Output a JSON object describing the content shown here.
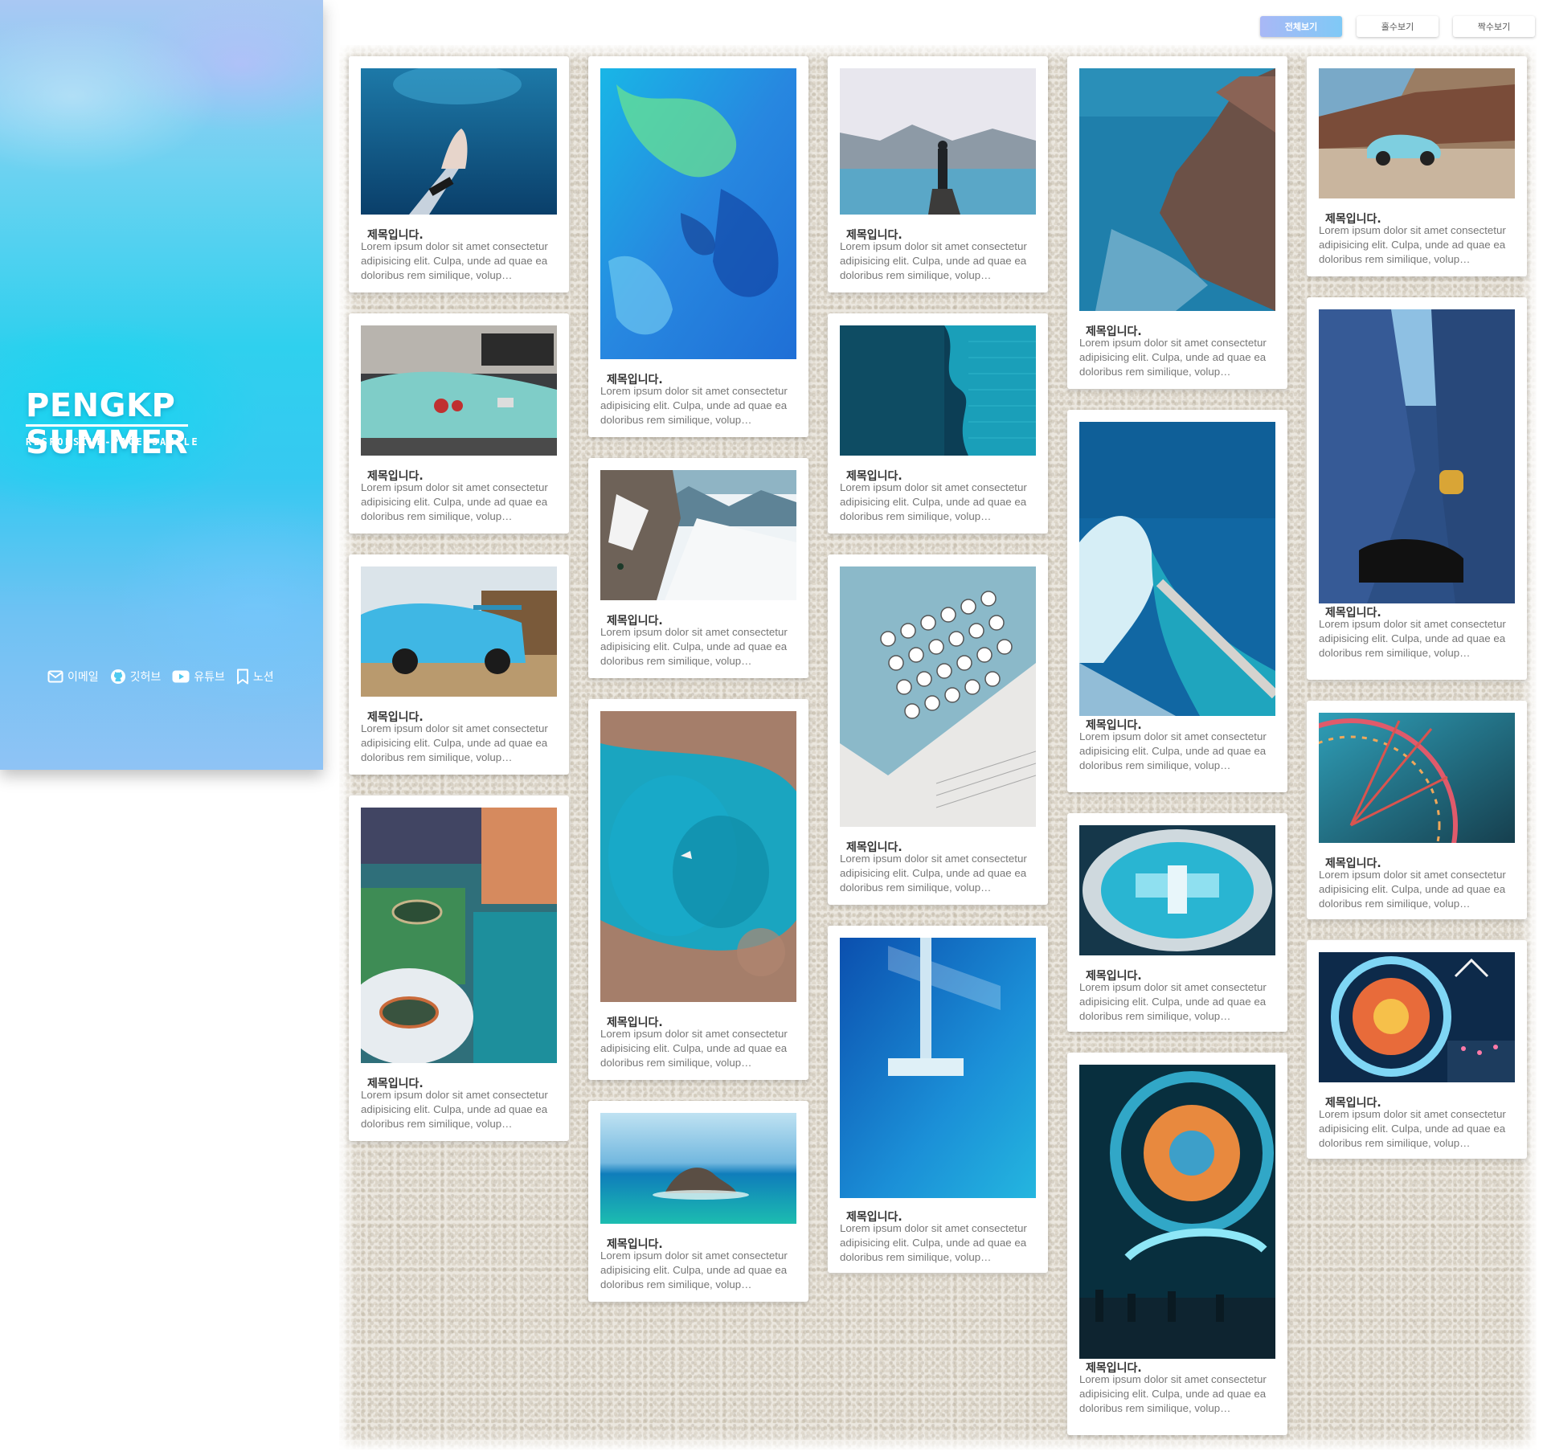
{
  "brand": {
    "title": "PENGKP SUMMER",
    "subtitle": "RESPONSIVE-PAGE-SAMPLE",
    "colors": {
      "accent": "#2fd0ee",
      "accent_secondary": "#a9b8f6"
    }
  },
  "social": [
    {
      "label": "이메일",
      "icon": "mail-icon"
    },
    {
      "label": "깃허브",
      "icon": "github-icon"
    },
    {
      "label": "유튜브",
      "icon": "youtube-icon"
    },
    {
      "label": "노션",
      "icon": "bookmark-icon"
    }
  ],
  "filters": [
    {
      "label": "전체보기",
      "active": true
    },
    {
      "label": "홀수보기",
      "active": false
    },
    {
      "label": "짝수보기",
      "active": false
    }
  ],
  "card_text": {
    "title": "제목입니다.",
    "desc": "Lorem ipsum dolor sit amet consectetur adipisicing elit. Culpa, unde ad quae ea doloribus rem similique, volup…"
  },
  "cards": [
    {
      "image": "underwater-hand",
      "title": "제목입니다.",
      "desc": "Lorem ipsum dolor sit amet consectetur adipisicing elit. Culpa, unde ad quae ea doloribus rem similique, volup…"
    },
    {
      "image": "teal-vintage-car",
      "title": "제목입니다.",
      "desc": "Lorem ipsum dolor sit amet consectetur adipisicing elit. Culpa, unde ad quae ea doloribus rem similique, volup…"
    },
    {
      "image": "blue-sports-car",
      "title": "제목입니다.",
      "desc": "Lorem ipsum dolor sit amet consectetur adipisicing elit. Culpa, unde ad quae ea doloribus rem similique, volup…"
    },
    {
      "image": "table-setting",
      "title": "제목입니다.",
      "desc": "Lorem ipsum dolor sit amet consectetur adipisicing elit. Culpa, unde ad quae ea doloribus rem similique, volup…"
    },
    {
      "image": "blue-abstract",
      "title": "제목입니다.",
      "desc": "Lorem ipsum dolor sit amet consectetur adipisicing elit. Culpa, unde ad quae ea doloribus rem similique, volup…"
    },
    {
      "image": "snow-mountain",
      "title": "제목입니다.",
      "desc": "Lorem ipsum dolor sit amet consectetur adipisicing elit. Culpa, unde ad quae ea doloribus rem similique, volup…"
    },
    {
      "image": "aerial-lagoon",
      "title": "제목입니다.",
      "desc": "Lorem ipsum dolor sit amet consectetur adipisicing elit. Culpa, unde ad quae ea doloribus rem similique, volup…"
    },
    {
      "image": "rock-island",
      "title": "제목입니다.",
      "desc": "Lorem ipsum dolor sit amet consectetur adipisicing elit. Culpa, unde ad quae ea doloribus rem similique, volup…"
    },
    {
      "image": "lake-person",
      "title": "제목입니다.",
      "desc": "Lorem ipsum dolor sit amet consectetur adipisicing elit. Culpa, unde ad quae ea doloribus rem similique, volup…"
    },
    {
      "image": "shadow-brick-wall",
      "title": "제목입니다.",
      "desc": "Lorem ipsum dolor sit amet consectetur adipisicing elit. Culpa, unde ad quae ea doloribus rem similique, volup…"
    },
    {
      "image": "typewriter",
      "title": "제목입니다.",
      "desc": "Lorem ipsum dolor sit amet consectetur adipisicing elit. Culpa, unde ad quae ea doloribus rem similique, volup…"
    },
    {
      "image": "blue-sign",
      "title": "제목입니다.",
      "desc": "Lorem ipsum dolor sit amet consectetur adipisicing elit. Culpa, unde ad quae ea doloribus rem similique, volup…"
    },
    {
      "image": "sea-cliffs",
      "title": "제목입니다.",
      "desc": "Lorem ipsum dolor sit amet consectetur adipisicing elit. Culpa, unde ad quae ea doloribus rem similique, volup…"
    },
    {
      "image": "ocean-wave-pool",
      "title": "제목입니다.",
      "desc": "Lorem ipsum dolor sit amet consectetur adipisicing elit. Culpa, unde ad quae ea doloribus rem similique, volup…"
    },
    {
      "image": "machine-part",
      "title": "제목입니다.",
      "desc": "Lorem ipsum dolor sit amet consectetur adipisicing elit. Culpa, unde ad quae ea doloribus rem similique, volup…"
    },
    {
      "image": "carnival-wheel-night",
      "title": "제목입니다.",
      "desc": "Lorem ipsum dolor sit amet consectetur adipisicing elit. Culpa, unde ad quae ea doloribus rem similique, volup…"
    },
    {
      "image": "beetle-car-beach",
      "title": "제목입니다.",
      "desc": "Lorem ipsum dolor sit amet consectetur adipisicing elit. Culpa, unde ad quae ea doloribus rem similique, volup…"
    },
    {
      "image": "tying-shoe",
      "title": "제목입니다.",
      "desc": "Lorem ipsum dolor sit amet consectetur adipisicing elit. Culpa, unde ad quae ea doloribus rem similique, volup…"
    },
    {
      "image": "ferris-wheel",
      "title": "제목입니다.",
      "desc": "Lorem ipsum dolor sit amet consectetur adipisicing elit. Culpa, unde ad quae ea doloribus rem similique, volup…"
    },
    {
      "image": "spinning-ride",
      "title": "제목입니다.",
      "desc": "Lorem ipsum dolor sit amet consectetur adipisicing elit. Culpa, unde ad quae ea doloribus rem similique, volup…"
    }
  ]
}
